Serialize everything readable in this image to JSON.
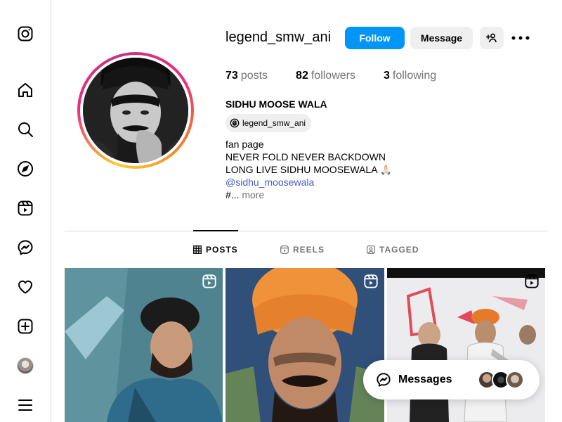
{
  "profile": {
    "username": "legend_smw_ani",
    "follow_label": "Follow",
    "message_label": "Message",
    "stats": {
      "posts_count": "73",
      "posts_label": "posts",
      "followers_count": "82",
      "followers_label": "followers",
      "following_count": "3",
      "following_label": "following"
    },
    "full_name": "SIDHU MOOSE WALA",
    "threads_handle": "legend_smw_ani",
    "bio": {
      "line1": "fan page",
      "line2": "NEVER FOLD NEVER BACKDOWN",
      "line3": "LONG LIVE SIDHU MOOSEWALA 🙏🏻",
      "mention": "@sidhu_moosewala",
      "line5_prefix": "#...",
      "more": "more"
    }
  },
  "tabs": {
    "posts": "POSTS",
    "reels": "REELS",
    "tagged": "TAGGED"
  },
  "messages": {
    "label": "Messages"
  },
  "colors": {
    "accent": "#0095f6",
    "mention": "#4a5bc9",
    "muted": "#737373"
  },
  "icons": {
    "sidebar": [
      "instagram-icon",
      "home-icon",
      "search-icon",
      "explore-icon",
      "reels-icon",
      "messenger-icon",
      "heart-icon",
      "create-icon",
      "avatar",
      "menu-icon"
    ]
  }
}
